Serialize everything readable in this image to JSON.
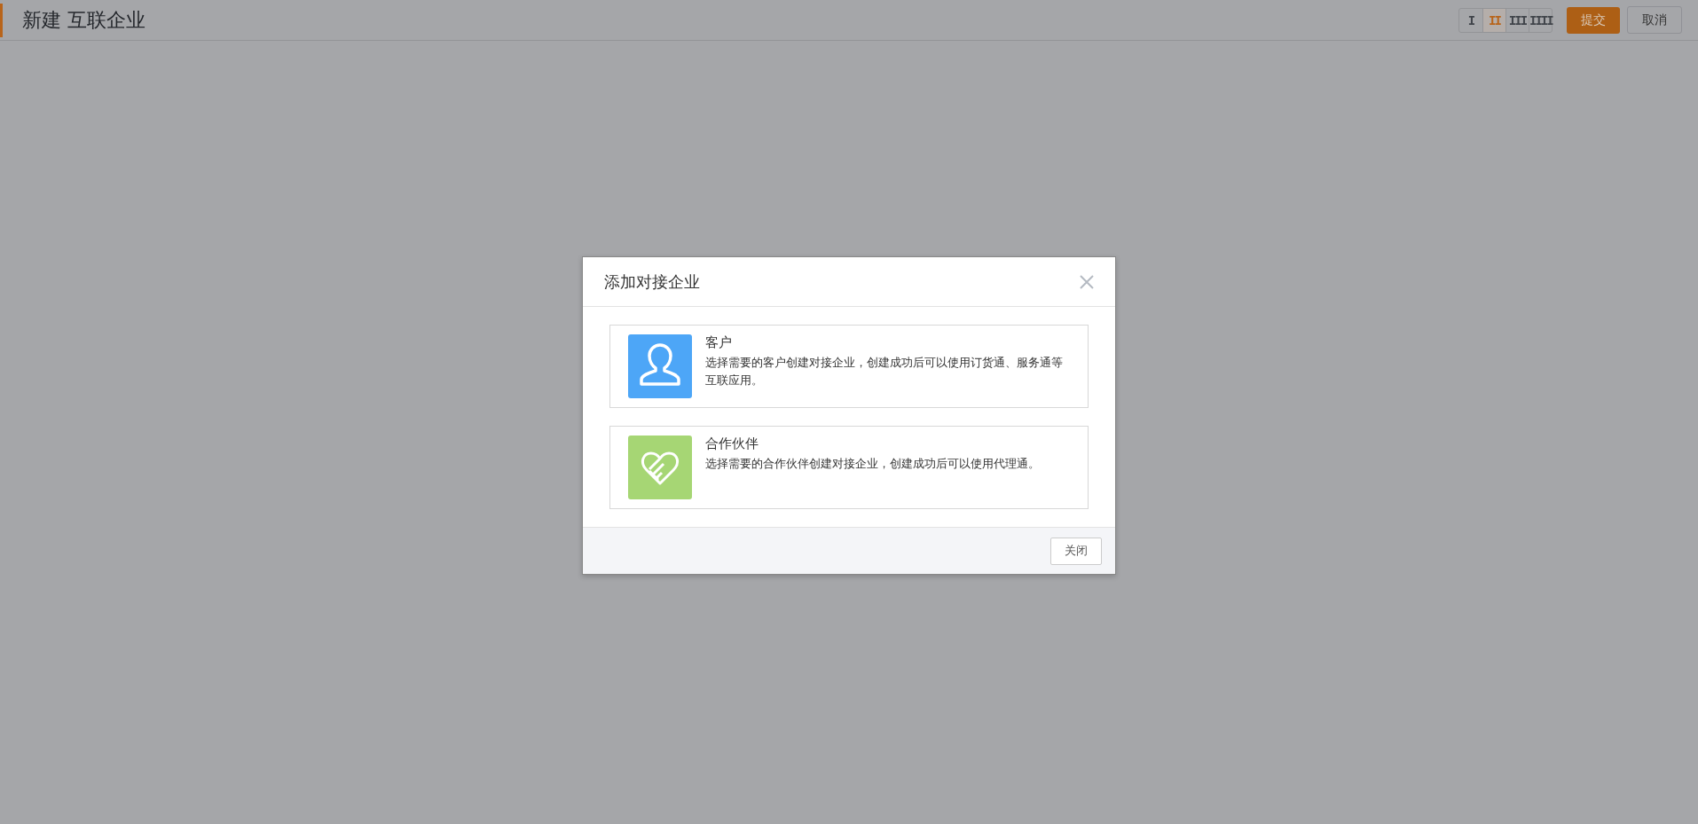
{
  "page": {
    "title": "新建 互联企业"
  },
  "layout_options": [
    {
      "label": "I",
      "selected": false
    },
    {
      "label": "II",
      "selected": true
    },
    {
      "label": "III",
      "selected": false
    },
    {
      "label": "IIII",
      "selected": false
    }
  ],
  "actions": {
    "submit": "提交",
    "cancel": "取消"
  },
  "dialog": {
    "title": "添加对接企业",
    "close": "关闭",
    "options": [
      {
        "kind": "person",
        "title": "客户",
        "description": "选择需要的客户创建对接企业，创建成功后可以使用订货通、服务通等互联应用。"
      },
      {
        "kind": "heart",
        "title": "合作伙伴",
        "description": "选择需要的合作伙伴创建对接企业，创建成功后可以使用代理通。"
      }
    ]
  }
}
